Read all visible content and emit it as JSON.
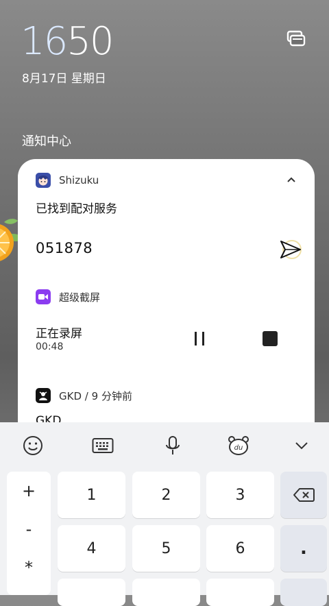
{
  "status": {
    "hour": "16",
    "minute": "50",
    "date": "8月17日  星期日"
  },
  "notification_center": {
    "title": "通知中心"
  },
  "notifications": {
    "shizuku": {
      "app_name": "Shizuku",
      "title": "已找到配对服务",
      "code": "051878"
    },
    "screen_record": {
      "app_name": "超级截屏",
      "title": "正在录屏",
      "elapsed": "00:48"
    },
    "gkd": {
      "app_name": "GKD",
      "time_ago": "9 分钟前",
      "separator": "/",
      "title_partial": "GKD"
    }
  },
  "keyboard": {
    "toolbar": [
      "emoji-icon",
      "keyboard-icon",
      "microphone-icon",
      "du-bear-icon",
      "chevron-down-icon"
    ],
    "side_symbols": [
      "+",
      "-",
      "*"
    ],
    "keys_row1": [
      "1",
      "2",
      "3"
    ],
    "keys_row2": [
      "4",
      "5",
      "6"
    ],
    "dot": ".",
    "accent": "#dfe3ec"
  }
}
